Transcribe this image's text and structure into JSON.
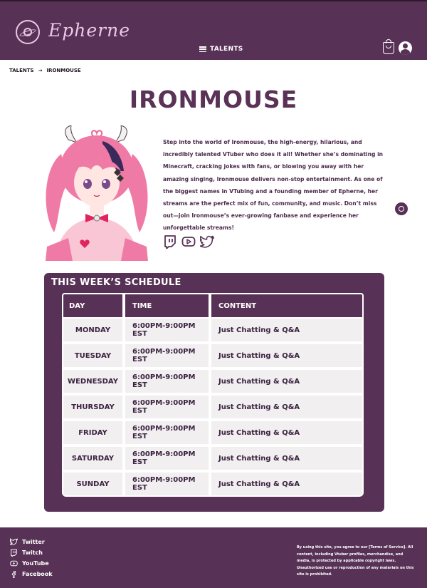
{
  "header": {
    "brand": "Epherne",
    "nav_label": "TALENTS",
    "cart_icon": "cart-icon",
    "account_icon": "account-icon"
  },
  "breadcrumb": {
    "items": [
      "TALENTS",
      "IRONMOUSE"
    ],
    "separator": "→"
  },
  "talent": {
    "name": "IRONMOUSE",
    "bio": "Step into the world of Ironmouse, the high-energy, hilarious, and incredibly talented VTuber who does it all! Whether she’s dominating in Minecraft, cracking jokes with fans, or blowing you away with her amazing singing, Ironmouse delivers non-stop entertainment. As one of the biggest names in VTubing and a founding member of Epherne, her streams are the perfect mix of fun, community, and music. Don’t miss out—join Ironmouse’s ever-growing fanbase and experience her unforgettable streams!",
    "socials": [
      "twitch-icon",
      "youtube-icon",
      "twitter-icon"
    ]
  },
  "schedule": {
    "title": "THIS WEEK’S SCHEDULE",
    "columns": [
      "DAY",
      "TIME",
      "CONTENT"
    ],
    "rows": [
      {
        "day": "MONDAY",
        "time": "6:00PM-9:00PM EST",
        "content": "Just Chatting & Q&A"
      },
      {
        "day": "TUESDAY",
        "time": "6:00PM-9:00PM EST",
        "content": "Just Chatting & Q&A"
      },
      {
        "day": "WEDNESDAY",
        "time": "6:00PM-9:00PM EST",
        "content": "Just Chatting & Q&A"
      },
      {
        "day": "THURSDAY",
        "time": "6:00PM-9:00PM EST",
        "content": "Just Chatting & Q&A"
      },
      {
        "day": "FRIDAY",
        "time": "6:00PM-9:00PM EST",
        "content": "Just Chatting & Q&A"
      },
      {
        "day": "SATURDAY",
        "time": "6:00PM-9:00PM EST",
        "content": "Just Chatting & Q&A"
      },
      {
        "day": "SUNDAY",
        "time": "6:00PM-9:00PM EST",
        "content": "Just Chatting & Q&A"
      }
    ]
  },
  "footer": {
    "links": [
      {
        "label": "Twitter",
        "icon": "twitter-icon"
      },
      {
        "label": "Twitch",
        "icon": "twitch-icon"
      },
      {
        "label": "YouTube",
        "icon": "youtube-icon"
      },
      {
        "label": "Facebook",
        "icon": "facebook-icon"
      }
    ],
    "legal": "By using this site, you agree to our [Terms of Service]. All content, including Vtuber profiles, merchandise, and media, is protected by applicable copyright laws. Unauthorized use or reproduction of any materials on this site is prohibited."
  },
  "colors": {
    "brand_purple": "#573156",
    "brand_pink": "#e9c9e6",
    "cell_bg": "#f1eff0"
  }
}
